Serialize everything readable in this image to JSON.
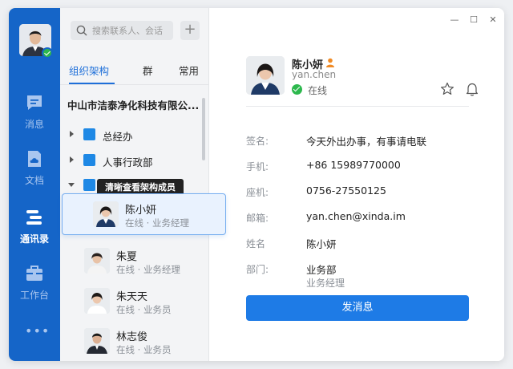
{
  "colors": {
    "rail": "#1565c8",
    "accent": "#1e6fd9",
    "online": "#2db84d",
    "button": "#1e7be6"
  },
  "sidebar": {
    "items": [
      {
        "label": "消息",
        "icon": "message-icon"
      },
      {
        "label": "文档",
        "icon": "document-cloud-icon"
      },
      {
        "label": "通讯录",
        "icon": "contacts-icon",
        "active": true
      },
      {
        "label": "工作台",
        "icon": "briefcase-icon"
      }
    ],
    "more": "•••"
  },
  "search": {
    "placeholder": "搜索联系人、会话"
  },
  "tabs": [
    {
      "label": "组织架构",
      "active": true
    },
    {
      "label": "群"
    },
    {
      "label": "常用"
    }
  ],
  "org": {
    "company": "中山市洁泰净化科技有限公...",
    "departments": [
      {
        "name": "总经办",
        "expanded": false
      },
      {
        "name": "人事行政部",
        "expanded": false
      },
      {
        "name": "",
        "expanded": true
      }
    ]
  },
  "tooltip": "清晰查看架构成员",
  "members": [
    {
      "name": "陈小妍",
      "status": "在线 · 业务经理",
      "selected": true
    },
    {
      "name": "朱夏",
      "status": "在线 · 业务经理"
    },
    {
      "name": "朱天天",
      "status": "在线 · 业务员"
    },
    {
      "name": "林志俊",
      "status": "在线 · 业务员"
    }
  ],
  "window_controls": [
    "—",
    "☐",
    "✕"
  ],
  "profile": {
    "name": "陈小妍",
    "uid": "yan.chen",
    "online": "在线",
    "fields": [
      {
        "label": "签名:",
        "value": "今天外出办事，有事请电联"
      },
      {
        "label": "手机:",
        "value": "+86 15989770000"
      },
      {
        "label": "座机:",
        "value": "0756-27550125"
      },
      {
        "label": "邮箱:",
        "value": "yan.chen@xinda.im"
      },
      {
        "label": "姓名",
        "value": "陈小妍"
      },
      {
        "label": "部门:",
        "value": "业务部",
        "sub": "业务经理"
      }
    ],
    "send_button": "发消息"
  }
}
